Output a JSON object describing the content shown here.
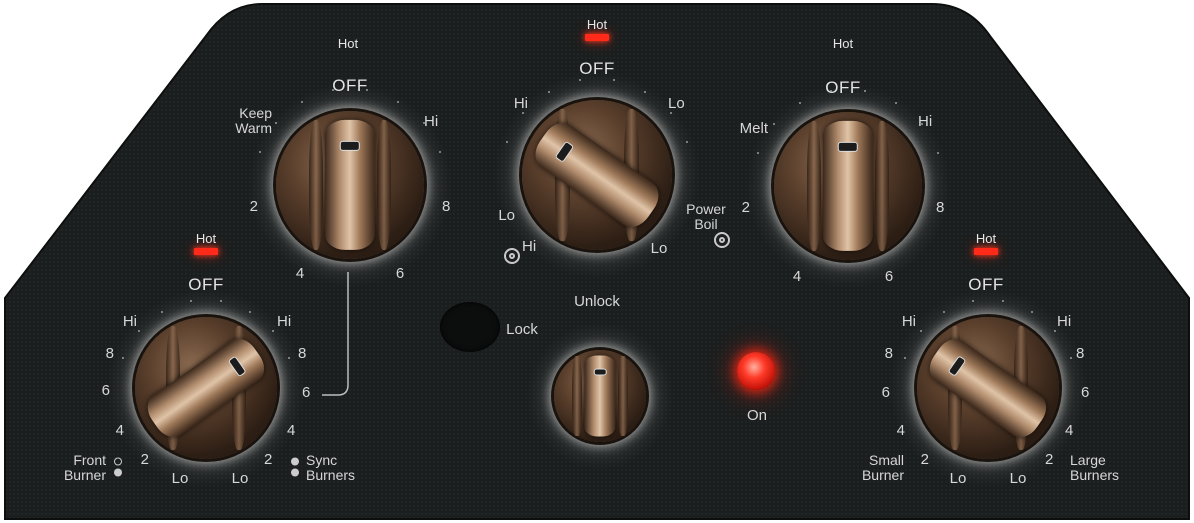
{
  "unlock_control": {
    "unlock_label": "Unlock",
    "lock_label": "Lock",
    "on_label": "On",
    "on_led_color": "#ff2a1a"
  },
  "burners": {
    "left_front": {
      "hot_label": "Hot",
      "off_label": "OFF",
      "left_scale": [
        "Hi",
        "8",
        "6",
        "4",
        "2",
        "Lo"
      ],
      "right_scale": [
        "Hi",
        "8",
        "6",
        "4",
        "2",
        "Lo"
      ],
      "front_burner_label": "Front\nBurner",
      "sync_burners_label": "Sync\nBurners"
    },
    "left_rear": {
      "hot_label": "Hot",
      "off_label": "OFF",
      "scale_labels": [
        "Keep\nWarm",
        "Hi",
        "8",
        "6",
        "4",
        "2"
      ]
    },
    "center": {
      "hot_label": "Hot",
      "off_label": "OFF",
      "scale_labels": [
        "Hi",
        "Lo",
        "Lo",
        "Hi",
        "Lo",
        "Power\nBoil"
      ]
    },
    "right_rear": {
      "hot_label": "Hot",
      "off_label": "OFF",
      "scale_labels": [
        "Melt",
        "Hi",
        "8",
        "6",
        "4",
        "2"
      ]
    },
    "right_front": {
      "hot_label": "Hot",
      "off_label": "OFF",
      "left_scale": [
        "Hi",
        "8",
        "6",
        "4",
        "2",
        "Lo"
      ],
      "right_scale": [
        "Hi",
        "8",
        "6",
        "4",
        "2",
        "Lo"
      ],
      "small_burner_label": "Small\nBurner",
      "large_burners_label": "Large\nBurners"
    }
  },
  "colors": {
    "panel": "#1a1d1d",
    "hot_indicator": "#ff2a1a",
    "knob": "#7a5a40",
    "text": "#d7d7d7"
  }
}
